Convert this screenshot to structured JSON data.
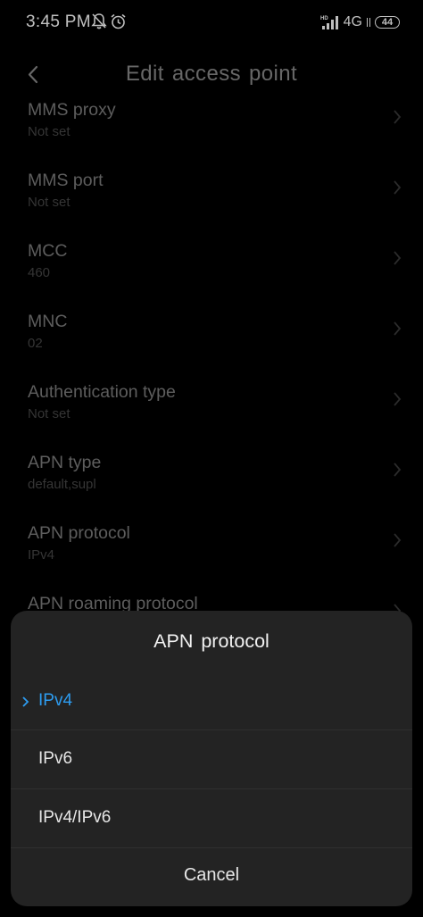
{
  "status_bar": {
    "time": "3:45 PM",
    "network": "4G",
    "hd_label": "HD",
    "battery": "44",
    "icons": [
      "mute-notifications-icon",
      "alarm-icon",
      "signal-icon",
      "battery-icon"
    ]
  },
  "header": {
    "title": "Edit access point",
    "back_icon": "chevron-left-icon"
  },
  "settings": [
    {
      "title": "MMS proxy",
      "value": "Not set"
    },
    {
      "title": "MMS port",
      "value": "Not set"
    },
    {
      "title": "MCC",
      "value": "460"
    },
    {
      "title": "MNC",
      "value": "02"
    },
    {
      "title": "Authentication type",
      "value": "Not set"
    },
    {
      "title": "APN type",
      "value": "default,supl"
    },
    {
      "title": "APN protocol",
      "value": "IPv4"
    },
    {
      "title": "APN roaming protocol",
      "value": ""
    }
  ],
  "dialog": {
    "title": "APN protocol",
    "options": [
      {
        "label": "IPv4",
        "selected": true
      },
      {
        "label": "IPv6",
        "selected": false
      },
      {
        "label": "IPv4/IPv6",
        "selected": false
      }
    ],
    "cancel_label": "Cancel"
  },
  "colors": {
    "background": "#000000",
    "dialog_bg": "#232323",
    "accent": "#2d9cf0",
    "text_primary": "#e6e6e6",
    "text_dim": "#7d7d7d"
  }
}
